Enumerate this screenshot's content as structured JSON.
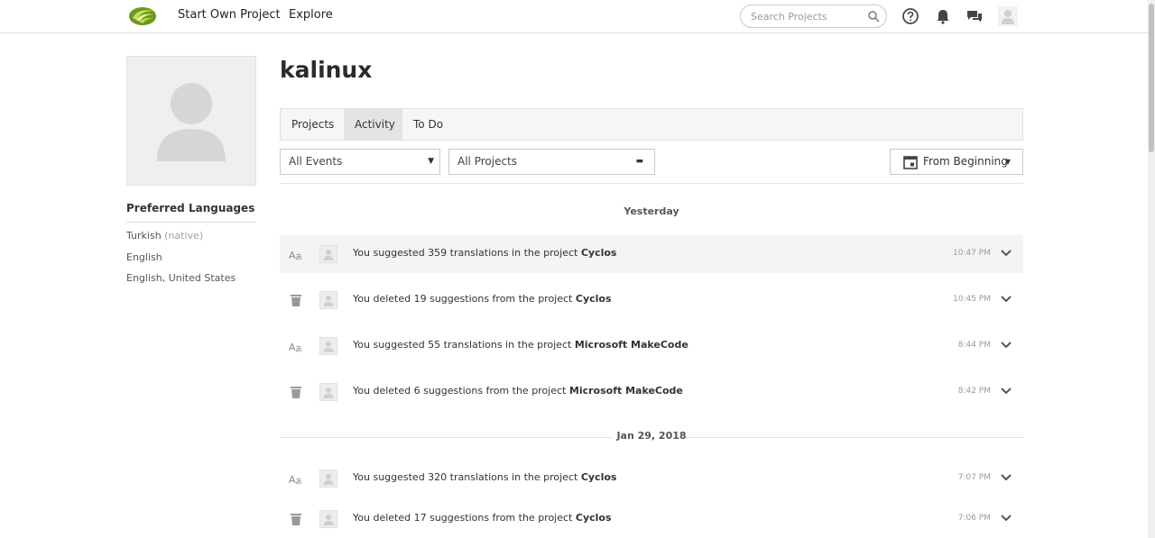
{
  "nav": {
    "start_project": "Start Own Project",
    "explore": "Explore",
    "search_placeholder": "Search Projects",
    "icons": [
      "help-circle-icon",
      "bell-icon",
      "chat-icon",
      "user-icon"
    ]
  },
  "profile": {
    "username": "kalinux",
    "preferred_languages_title": "Preferred Languages",
    "languages": [
      {
        "name": "Turkish",
        "note": "(native)"
      },
      {
        "name": "English",
        "note": ""
      },
      {
        "name": "English, United States",
        "note": ""
      }
    ]
  },
  "tabs": [
    {
      "label": "Projects",
      "active": false
    },
    {
      "label": "Activity",
      "active": true
    },
    {
      "label": "To Do",
      "active": false
    }
  ],
  "filters": {
    "events": "All Events",
    "projects": "All Projects",
    "range": "From Beginning"
  },
  "groups": [
    {
      "date": "Yesterday",
      "items": [
        {
          "type": "translate",
          "text": "You suggested 359 translations in the project",
          "project": "Cyclos",
          "time": "10:47 PM"
        },
        {
          "type": "delete",
          "text": "You deleted 19 suggestions from the project",
          "project": "Cyclos",
          "time": "10:45 PM"
        },
        {
          "type": "translate",
          "text": "You suggested 55 translations in the project",
          "project": "Microsoft MakeCode",
          "time": "8:44 PM"
        },
        {
          "type": "delete",
          "text": "You deleted 6 suggestions from the project",
          "project": "Microsoft MakeCode",
          "time": "8:42 PM"
        }
      ]
    },
    {
      "date": "Jan 29, 2018",
      "items": [
        {
          "type": "translate",
          "text": "You suggested 320 translations in the project",
          "project": "Cyclos",
          "time": "7:07 PM"
        },
        {
          "type": "delete",
          "text": "You deleted 17 suggestions from the project",
          "project": "Cyclos",
          "time": "7:06 PM"
        }
      ]
    }
  ],
  "colors": {
    "accent_green": "#8dc63f",
    "highlight_row": "#f4f4f4",
    "active_tab": "#e4e4e4"
  }
}
